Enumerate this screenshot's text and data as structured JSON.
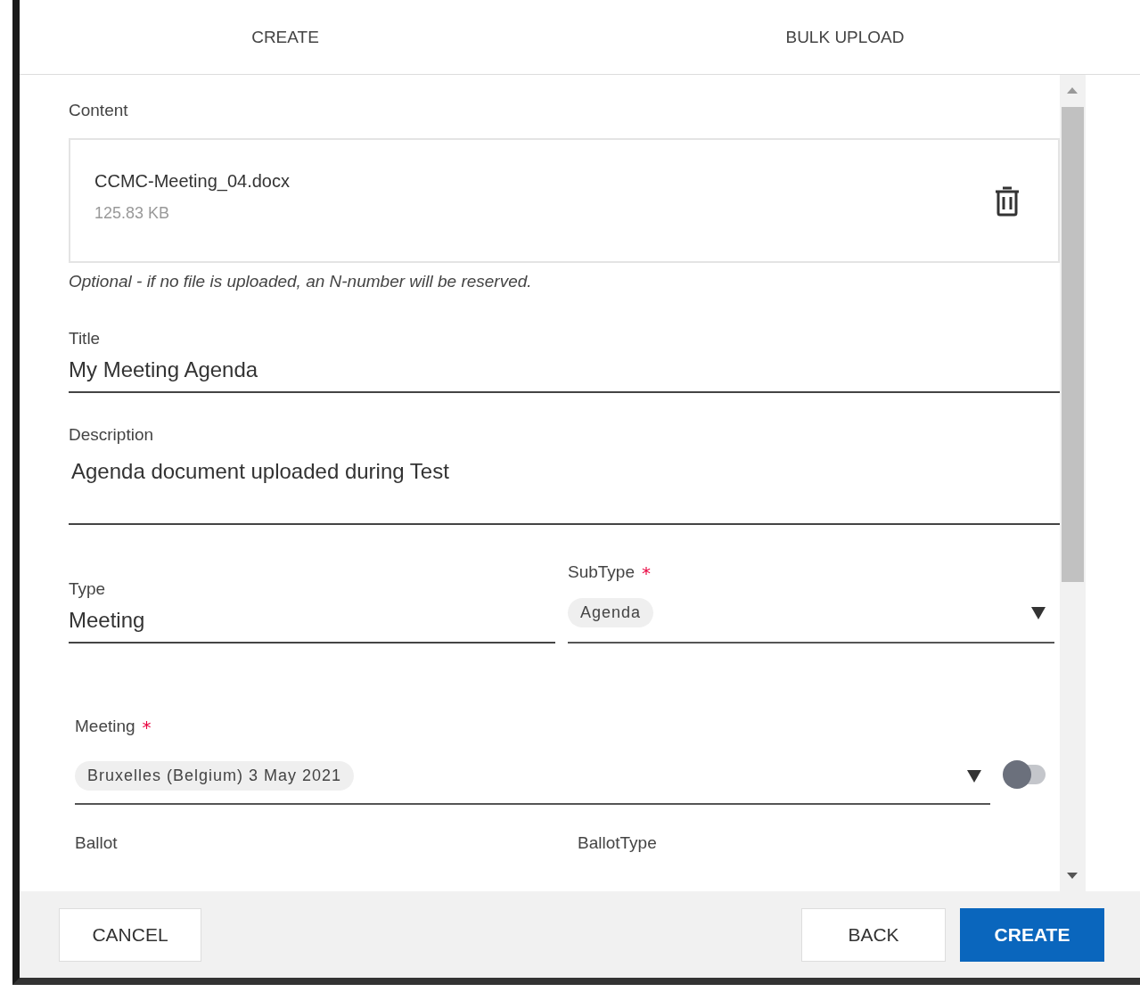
{
  "tabs": [
    {
      "label": "CREATE"
    },
    {
      "label": "BULK UPLOAD"
    }
  ],
  "content": {
    "label": "Content",
    "file_name": "CCMC-Meeting_04.docx",
    "file_size": "125.83 KB",
    "hint": "Optional - if no file is uploaded, an N-number will be reserved."
  },
  "title": {
    "label": "Title",
    "value": "My Meeting Agenda"
  },
  "description": {
    "label": "Description",
    "value": "Agenda document uploaded during Test"
  },
  "type": {
    "label": "Type",
    "value": "Meeting"
  },
  "subtype": {
    "label": "SubType",
    "required_mark": "*",
    "chip": "Agenda"
  },
  "meeting": {
    "label": "Meeting",
    "required_mark": "*",
    "chip": "Bruxelles (Belgium) 3 May 2021",
    "toggle_on": false
  },
  "ballot": {
    "label": "Ballot"
  },
  "ballot_type": {
    "label": "BallotType"
  },
  "buttons": [
    {
      "label": "CANCEL",
      "kind": "secondary"
    },
    {
      "label": "BACK",
      "kind": "secondary"
    },
    {
      "label": "CREATE",
      "kind": "primary"
    }
  ]
}
